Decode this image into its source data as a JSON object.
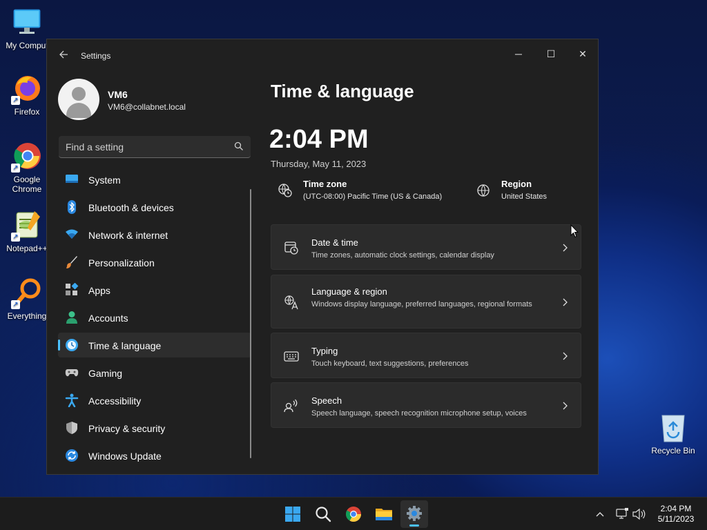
{
  "desktop": {
    "icons": [
      {
        "label": "My Comput",
        "icon": "computer-icon"
      },
      {
        "label": "Firefox",
        "icon": "firefox-icon"
      },
      {
        "label": "Google Chrome",
        "icon": "chrome-icon"
      },
      {
        "label": "Notepad++",
        "icon": "notepad-plus-plus-icon"
      },
      {
        "label": "Everything",
        "icon": "everything-search-icon"
      }
    ],
    "recycle_bin": "Recycle Bin"
  },
  "window": {
    "title": "Settings",
    "back_icon": "back-arrow-icon",
    "controls": {
      "minimize": "─",
      "maximize": "☐",
      "close": "✕"
    }
  },
  "user": {
    "name": "VM6",
    "email": "VM6@collabnet.local"
  },
  "search": {
    "placeholder": "Find a setting"
  },
  "nav": {
    "items": [
      {
        "label": "System",
        "icon": "system-icon"
      },
      {
        "label": "Bluetooth & devices",
        "icon": "bluetooth-icon"
      },
      {
        "label": "Network & internet",
        "icon": "wifi-icon"
      },
      {
        "label": "Personalization",
        "icon": "brush-icon"
      },
      {
        "label": "Apps",
        "icon": "apps-icon"
      },
      {
        "label": "Accounts",
        "icon": "accounts-icon"
      },
      {
        "label": "Time & language",
        "icon": "time-language-icon",
        "active": true
      },
      {
        "label": "Gaming",
        "icon": "gamepad-icon"
      },
      {
        "label": "Accessibility",
        "icon": "accessibility-icon"
      },
      {
        "label": "Privacy & security",
        "icon": "shield-icon"
      },
      {
        "label": "Windows Update",
        "icon": "update-icon"
      }
    ]
  },
  "content": {
    "title": "Time & language",
    "time": "2:04 PM",
    "date": "Thursday, May 11, 2023",
    "timezone": {
      "title": "Time zone",
      "value": "(UTC-08:00) Pacific Time (US & Canada)"
    },
    "region": {
      "title": "Region",
      "value": "United States"
    },
    "cards": [
      {
        "title": "Date & time",
        "subtitle": "Time zones, automatic clock settings, calendar display",
        "icon": "calendar-clock-icon"
      },
      {
        "title": "Language & region",
        "subtitle": "Windows display language, preferred languages, regional formats",
        "icon": "language-icon"
      },
      {
        "title": "Typing",
        "subtitle": "Touch keyboard, text suggestions, preferences",
        "icon": "keyboard-icon"
      },
      {
        "title": "Speech",
        "subtitle": "Speech language, speech recognition microphone setup, voices",
        "icon": "speech-icon"
      }
    ]
  },
  "taskbar": {
    "apps": [
      "start-icon",
      "search-icon",
      "chrome-icon",
      "file-explorer-icon",
      "settings-icon"
    ],
    "clock_time": "2:04 PM",
    "clock_date": "5/11/2023"
  },
  "colors": {
    "accent": "#4cc2ff",
    "window_bg": "#202020",
    "card_bg": "#2b2b2b"
  }
}
